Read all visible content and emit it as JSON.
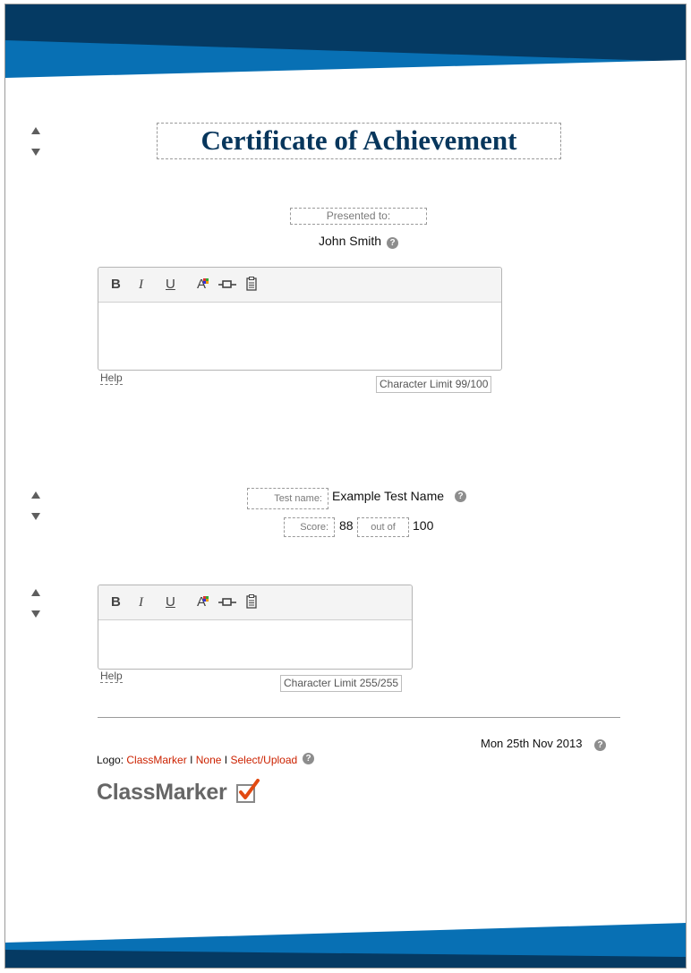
{
  "certificate": {
    "title": "Certificate of Achievement",
    "presented_label": "Presented to:",
    "recipient": "John Smith"
  },
  "editor_toolbar": {
    "bold": "B",
    "italic": "I",
    "underline": "U",
    "font_color": "A"
  },
  "editor1": {
    "help_label": "Help",
    "char_limit": "Character Limit 99/100"
  },
  "test": {
    "name_label": "Test name:",
    "name_value": "Example Test Name",
    "score_label": "Score:",
    "score_value": "88",
    "out_of_label": "out of",
    "out_of_value": "100"
  },
  "editor2": {
    "help_label": "Help",
    "char_limit": "Character Limit 255/255"
  },
  "date": "Mon 25th Nov 2013",
  "logo": {
    "label": "Logo:",
    "option_classmarker": "ClassMarker",
    "separator": "I",
    "option_none": "None",
    "option_upload": "Select/Upload",
    "brand_text": "ClassMarker"
  },
  "colors": {
    "banner_dark": "#053a63",
    "banner_light": "#0870b4",
    "title": "#07365c",
    "link": "#cc2200"
  }
}
